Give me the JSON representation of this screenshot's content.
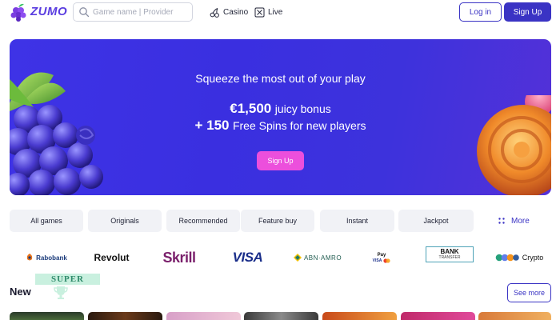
{
  "header": {
    "logo_text": "ZUMO",
    "search_placeholder": "Game name | Provider",
    "nav": [
      {
        "label": "Casino",
        "icon": "cherries-icon"
      },
      {
        "label": "Live",
        "icon": "live-card-icon"
      }
    ],
    "login_label": "Log in",
    "signup_label": "Sign Up"
  },
  "hero": {
    "subtitle": "Squeeze the most out of your play",
    "bonus_amount": "€1,500",
    "bonus_text": "juicy bonus",
    "spins_amount": "+ 150",
    "spins_text": "Free Spins for new players",
    "cta_label": "Sign Up"
  },
  "categories": [
    {
      "label": "All games"
    },
    {
      "label": "Originals"
    },
    {
      "label": "Recommended"
    },
    {
      "label": "Feature buy"
    },
    {
      "label": "Instant"
    },
    {
      "label": "Jackpot"
    }
  ],
  "more_label": "More",
  "payments": {
    "rabobank": "Rabobank",
    "revolut": "Revolut",
    "skrill": "Skrill",
    "visa": "VISA",
    "abnamro": "ABN·AMRO",
    "applepay": "Pay",
    "applepay_visa": "VISA",
    "bank_line1": "BANK",
    "bank_line2": "TRANSFER",
    "crypto": "Crypto"
  },
  "new_section": {
    "title": "New",
    "badge": "SUPER",
    "see_more_label": "See more"
  },
  "colors": {
    "brand": "#3a33c4",
    "hero_bg": "#3e33e6",
    "cta_pink": "#ec4fdc",
    "category_bg": "#f1f2f6"
  }
}
